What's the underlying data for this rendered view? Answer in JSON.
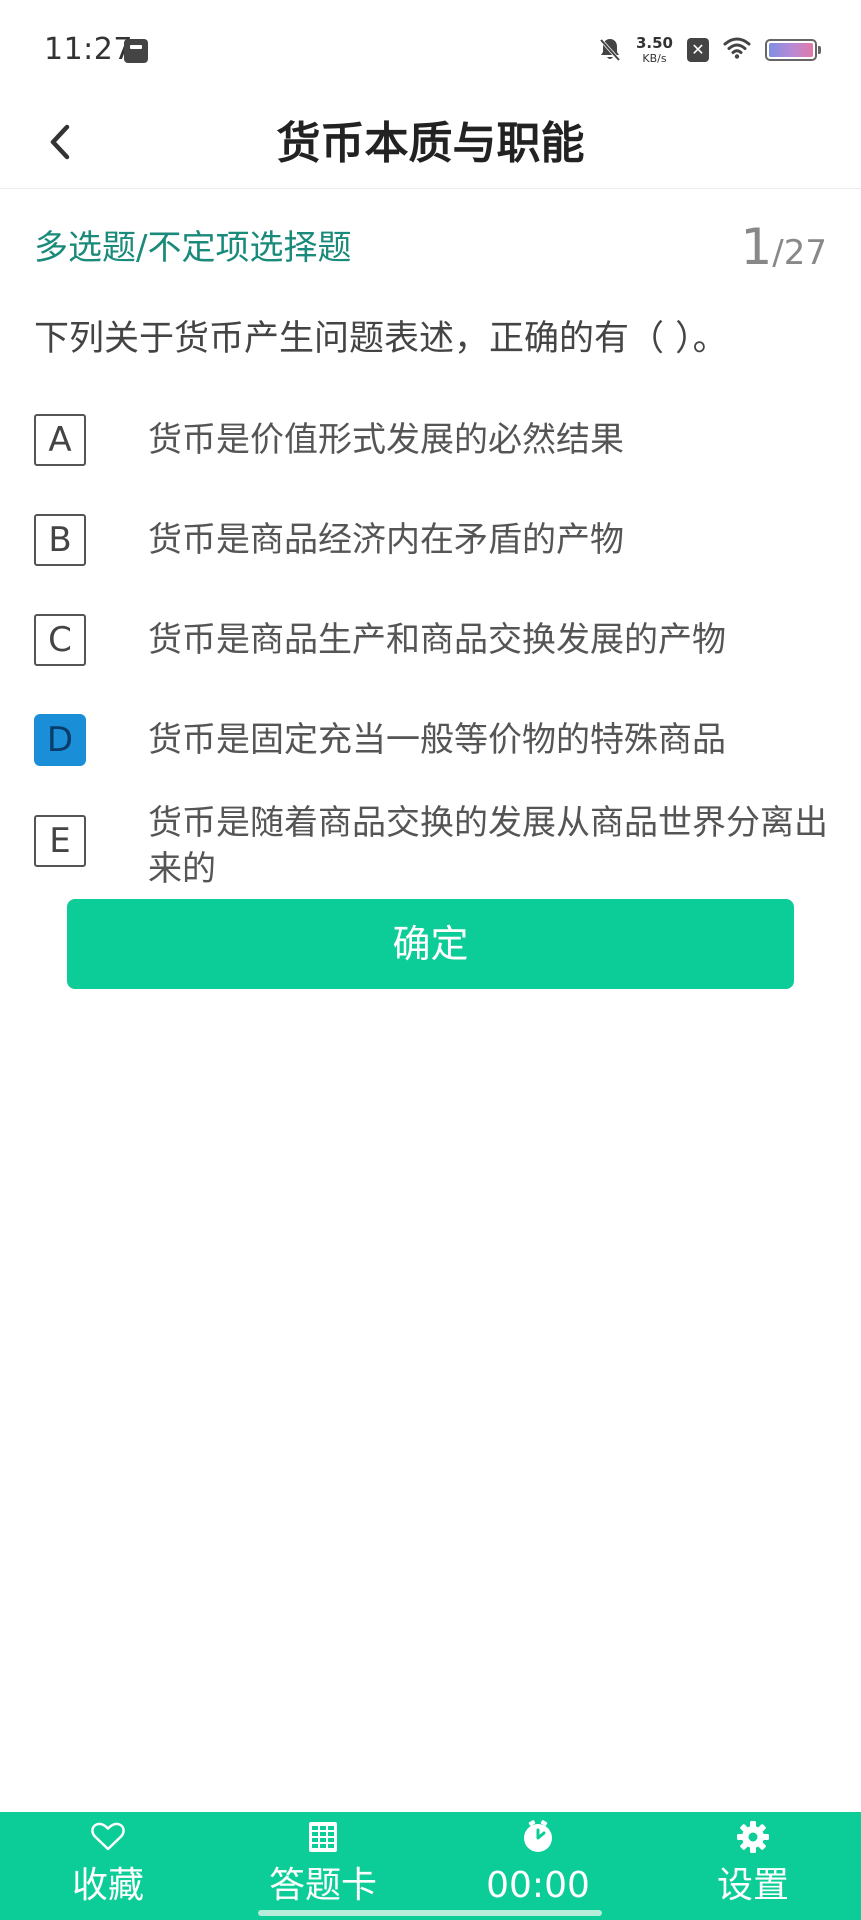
{
  "status_bar": {
    "time": "11:27",
    "net_speed_value": "3.50",
    "net_speed_unit": "KB/s"
  },
  "header": {
    "title": "货币本质与职能"
  },
  "question": {
    "type": "多选题/不定项选择题",
    "current": "1",
    "total": "/27",
    "text": "下列关于货币产生问题表述，正确的有（  ）。",
    "options": [
      {
        "letter": "A",
        "text": "货币是价值形式发展的必然结果",
        "selected": false
      },
      {
        "letter": "B",
        "text": "货币是商品经济内在矛盾的产物",
        "selected": false
      },
      {
        "letter": "C",
        "text": "货币是商品生产和商品交换发展的产物",
        "selected": false
      },
      {
        "letter": "D",
        "text": "货币是固定充当一般等价物的特殊商品",
        "selected": true
      },
      {
        "letter": "E",
        "text": "货币是随着商品交换的发展从商品世界分离出来的",
        "selected": false
      }
    ]
  },
  "confirm_label": "确定",
  "bottom_bar": {
    "favorite_label": "收藏",
    "answer_card_label": "答题卡",
    "timer": "00:00",
    "settings_label": "设置"
  },
  "colors": {
    "accent": "#0ccd97",
    "question_type": "#1a8a7a",
    "selected_option": "#1a8fd8"
  }
}
